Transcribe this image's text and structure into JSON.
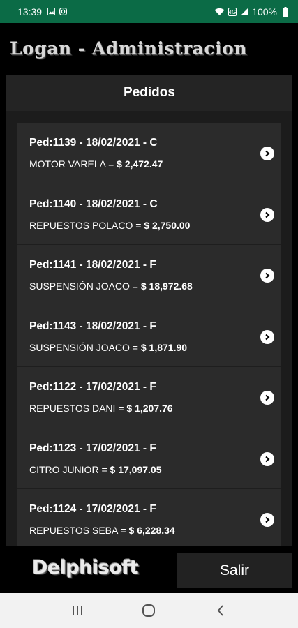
{
  "status": {
    "time": "13:39",
    "battery": "100%"
  },
  "app": {
    "title": "Logan - Administracion"
  },
  "panel": {
    "title": "Pedidos"
  },
  "orders": [
    {
      "header": "Ped:1139 - 18/02/2021 - C",
      "client": "MOTOR VARELA = ",
      "amount": "$ 2,472.47"
    },
    {
      "header": "Ped:1140 - 18/02/2021 - C",
      "client": "REPUESTOS POLACO = ",
      "amount": "$ 2,750.00"
    },
    {
      "header": "Ped:1141 - 18/02/2021 - F",
      "client": "SUSPENSIÓN JOACO = ",
      "amount": "$ 18,972.68"
    },
    {
      "header": "Ped:1143 - 18/02/2021 - F",
      "client": "SUSPENSIÓN JOACO = ",
      "amount": "$ 1,871.90"
    },
    {
      "header": "Ped:1122 - 17/02/2021 - F",
      "client": "REPUESTOS DANI = ",
      "amount": "$ 1,207.76"
    },
    {
      "header": "Ped:1123 - 17/02/2021 - F",
      "client": "CITRO JUNIOR = ",
      "amount": "$ 17,097.05"
    },
    {
      "header": "Ped:1124 - 17/02/2021 - F",
      "client": "REPUESTOS SEBA = ",
      "amount": "$ 6,228.34"
    }
  ],
  "footer": {
    "logo": "Delphisoft",
    "exit_label": "Salir"
  },
  "colors": {
    "statusbar": "#0b6b46",
    "panel": "#1c1c1c",
    "row": "#2b2b2b"
  }
}
